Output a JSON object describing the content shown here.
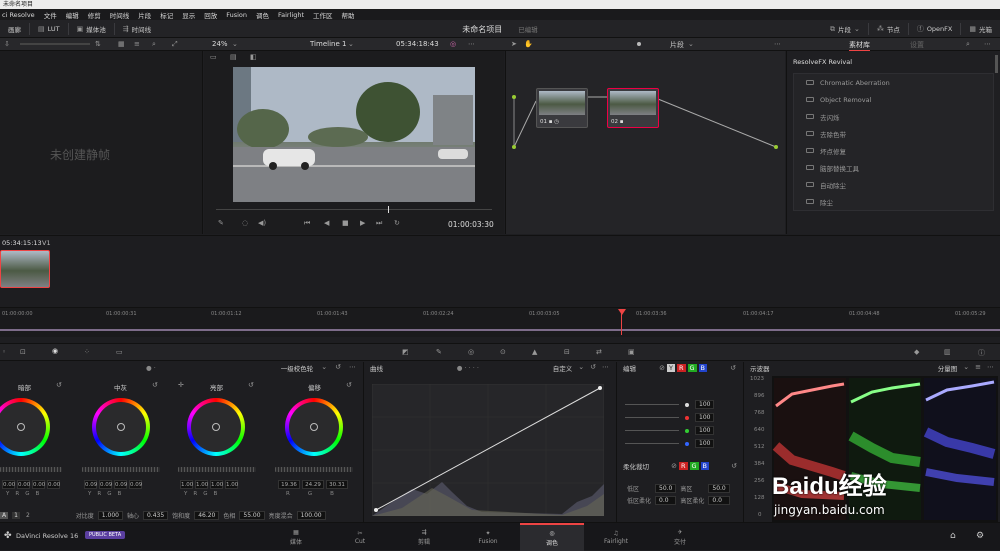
{
  "window_title": "未命名项目",
  "menu": [
    "ci Resolve",
    "文件",
    "编辑",
    "修剪",
    "时间线",
    "片段",
    "标记",
    "显示",
    "回放",
    "Fusion",
    "调色",
    "Fairlight",
    "工作区",
    "帮助"
  ],
  "topbar": {
    "gallery": "画廊",
    "lut": "LUT",
    "media_pool": "媒体池",
    "timeline": "时间线",
    "project": "未命名项目",
    "status": "已编辑",
    "clip": "片段",
    "nodes": "节点",
    "openfx": "OpenFX",
    "lightbox": "光箱"
  },
  "viewer": {
    "zoom": "24%",
    "timeline_name": "Timeline 1",
    "timecode": "05:34:18:43",
    "play_tc": "01:00:03:30"
  },
  "gallery": {
    "empty": "未创建静帧"
  },
  "nodes_bar": {
    "mode": "片段"
  },
  "fx": {
    "tab_library": "素材库",
    "tab_settings": "设置",
    "title": "ResolveFX Revival",
    "items": [
      "Chromatic Aberration",
      "Object Removal",
      "去闪烁",
      "去除色带",
      "坏点修复",
      "脑部替换工具",
      "自动除尘",
      "除尘"
    ]
  },
  "clip": {
    "tc": "05:34:15:13",
    "track": "V1"
  },
  "ruler_ticks": [
    "01:00:00:00",
    "01:00:00:31",
    "01:00:01:12",
    "01:00:01:43",
    "01:00:02:24",
    "01:00:03:05",
    "01:00:03:36",
    "01:00:04:17",
    "01:00:04:48",
    "01:00:05:29"
  ],
  "wheels_header": "一级校色轮",
  "wheels": [
    {
      "label": "暗部",
      "vals": [
        "0.00",
        "0.00",
        "0.00",
        "0.00"
      ],
      "chn": [
        "Y",
        "R",
        "G",
        "B"
      ]
    },
    {
      "label": "中灰",
      "vals": [
        "0.09",
        "0.09",
        "0.09",
        "0.09"
      ],
      "chn": [
        "Y",
        "R",
        "G",
        "B"
      ]
    },
    {
      "label": "亮部",
      "vals": [
        "1.00",
        "1.00",
        "1.00",
        "1.00"
      ],
      "chn": [
        "Y",
        "R",
        "G",
        "B"
      ]
    },
    {
      "label": "偏移",
      "vals": [
        "19.36",
        "24.29",
        "30.31"
      ],
      "chn": [
        "R",
        "G",
        "B"
      ]
    }
  ],
  "wheel_footer": {
    "contrast_label": "对比度",
    "contrast": "1.000",
    "pivot_label": "轴心",
    "pivot": "0.435",
    "sat_label": "饱和度",
    "sat": "46.20",
    "hue_label": "色相",
    "hue": "55.00",
    "lum_label": "亮度混合",
    "lum": "100.00",
    "page1": "1",
    "page2": "2"
  },
  "curves": {
    "title": "曲线",
    "mode": "自定义"
  },
  "edit": {
    "title": "编辑",
    "y": "Y",
    "r": "R",
    "g": "G",
    "b": "B",
    "vals": [
      "100",
      "100",
      "100",
      "100"
    ],
    "soft_title": "柔化裁切",
    "labels": [
      "低区",
      "高区",
      "低区柔化",
      "高区柔化"
    ],
    "soft_vals": [
      "50.0",
      "50.0",
      "0.0",
      "0.0"
    ]
  },
  "scope": {
    "title": "示波器",
    "mode": "分量图",
    "ticks": [
      "1023",
      "896",
      "768",
      "640",
      "512",
      "384",
      "256",
      "128",
      "0"
    ]
  },
  "bottom": {
    "app": "DaVinci Resolve 16",
    "badge": "PUBLIC BETA",
    "pages": [
      "媒体",
      "Cut",
      "剪辑",
      "Fusion",
      "调色",
      "Fairlight",
      "交付"
    ],
    "active": 4
  },
  "watermark": {
    "main": "Baidu经验",
    "url": "jingyan.baidu.com"
  }
}
